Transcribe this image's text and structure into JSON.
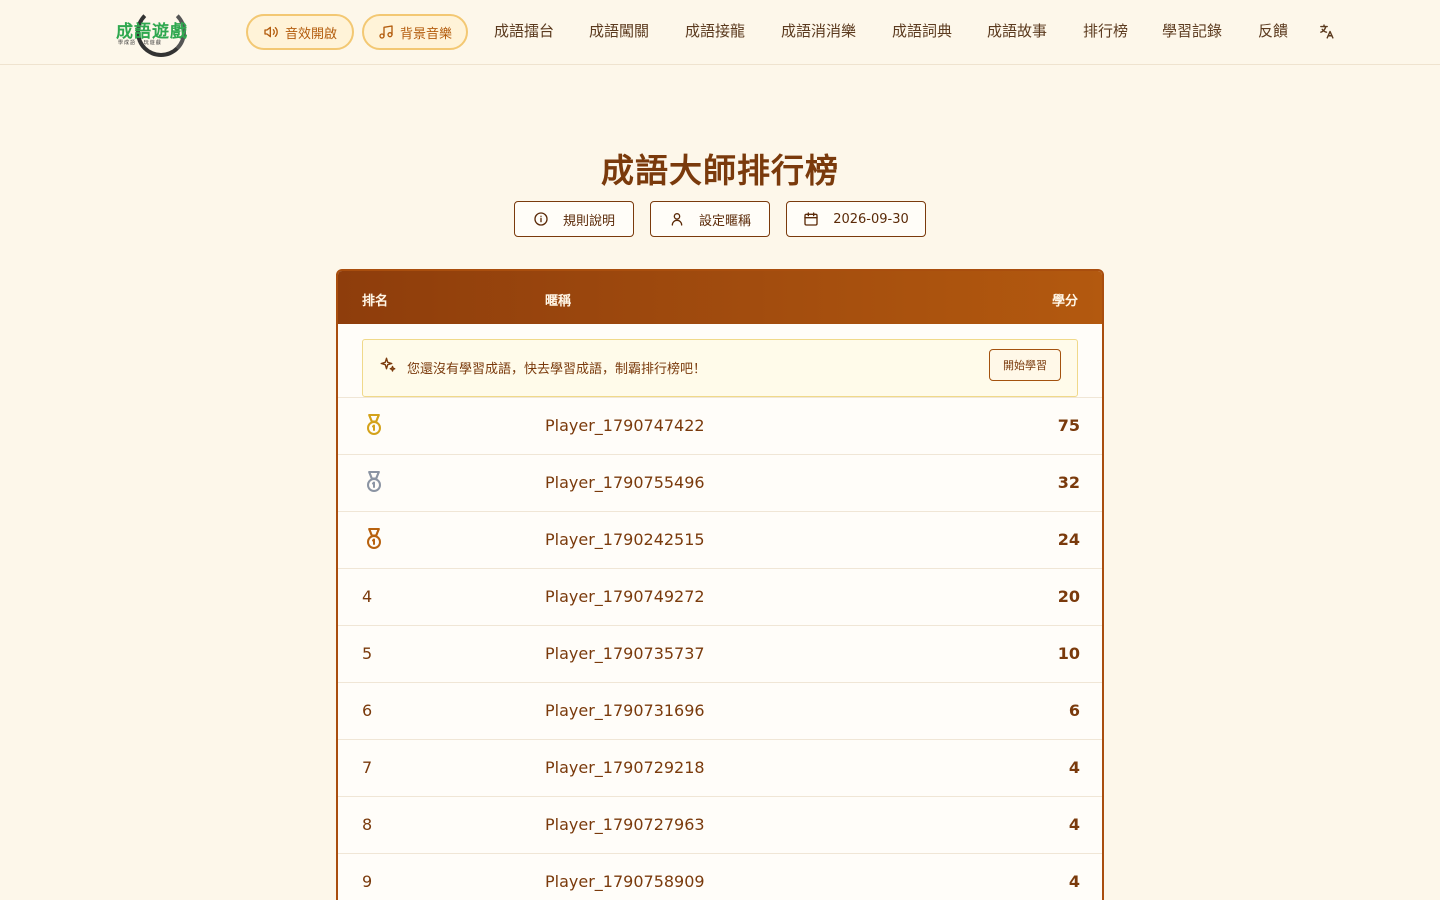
{
  "header": {
    "logo_text": "成語遊戲",
    "logo_subtext": "學成語 · 玩遊戲",
    "sound_toggle": "音效開啟",
    "music_toggle": "背景音樂",
    "nav": [
      "成語擂台",
      "成語闖關",
      "成語接龍",
      "成語消消樂",
      "成語詞典",
      "成語故事",
      "排行榜",
      "學習記錄",
      "反饋"
    ],
    "translate_icon": "translate-icon"
  },
  "page": {
    "title": "成語大師排行榜",
    "rules_button": "規則說明",
    "nickname_button": "設定暱稱",
    "date_button": "2026-09-30"
  },
  "leaderboard": {
    "columns": {
      "rank": "排名",
      "nickname": "暱稱",
      "score": "學分"
    },
    "notice": "您還沒有學習成語，快去學習成語，制霸排行榜吧！",
    "notice_button": "開始學習",
    "medal_colors": {
      "gold": "#d4a21a",
      "silver": "#8b94a3",
      "bronze": "#b8620f"
    },
    "rows": [
      {
        "rank": "1",
        "medal": "gold",
        "nickname": "Player_1790747422",
        "score": "75"
      },
      {
        "rank": "2",
        "medal": "silver",
        "nickname": "Player_1790755496",
        "score": "32"
      },
      {
        "rank": "3",
        "medal": "bronze",
        "nickname": "Player_1790242515",
        "score": "24"
      },
      {
        "rank": "4",
        "medal": "",
        "nickname": "Player_1790749272",
        "score": "20"
      },
      {
        "rank": "5",
        "medal": "",
        "nickname": "Player_1790735737",
        "score": "10"
      },
      {
        "rank": "6",
        "medal": "",
        "nickname": "Player_1790731696",
        "score": "6"
      },
      {
        "rank": "7",
        "medal": "",
        "nickname": "Player_1790729218",
        "score": "4"
      },
      {
        "rank": "8",
        "medal": "",
        "nickname": "Player_1790727963",
        "score": "4"
      },
      {
        "rank": "9",
        "medal": "",
        "nickname": "Player_1790758909",
        "score": "4"
      }
    ]
  }
}
